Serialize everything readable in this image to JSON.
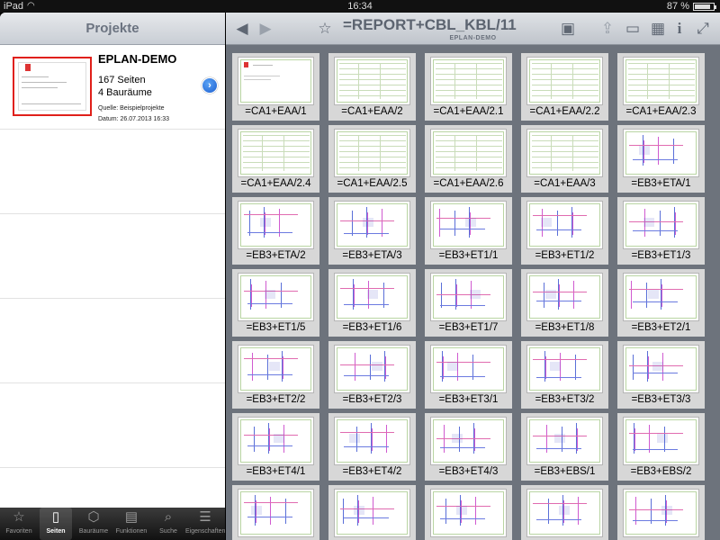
{
  "status": {
    "device": "iPad",
    "time": "16:34",
    "battery": "87 %",
    "battery_level": 0.87
  },
  "master": {
    "title": "Projekte",
    "project": {
      "name": "EPLAN-DEMO",
      "pages": "167 Seiten",
      "rooms": "4 Bauräume",
      "source": "Quelle: Beispielprojekte",
      "date": "Datum: 26.07.2013 16:33"
    }
  },
  "tabs": [
    {
      "label": "Favoriten",
      "icon": "star-icon",
      "active": false
    },
    {
      "label": "Seiten",
      "icon": "page-icon",
      "active": true
    },
    {
      "label": "Bauräume",
      "icon": "cube-icon",
      "active": false
    },
    {
      "label": "Funktionen",
      "icon": "function-icon",
      "active": false
    },
    {
      "label": "Suche",
      "icon": "search-icon",
      "active": false
    },
    {
      "label": "Eigenschaften",
      "icon": "properties-icon",
      "active": false
    }
  ],
  "detail": {
    "title": "=REPORT+CBL_KBL/11",
    "subtitle": "EPLAN-DEMO",
    "pages": [
      {
        "label": "=CA1+EAA/1",
        "kind": "cover"
      },
      {
        "label": "=CA1+EAA/2",
        "kind": "table"
      },
      {
        "label": "=CA1+EAA/2.1",
        "kind": "table"
      },
      {
        "label": "=CA1+EAA/2.2",
        "kind": "table"
      },
      {
        "label": "=CA1+EAA/2.3",
        "kind": "table"
      },
      {
        "label": "=CA1+EAA/2.4",
        "kind": "table"
      },
      {
        "label": "=CA1+EAA/2.5",
        "kind": "table"
      },
      {
        "label": "=CA1+EAA/2.6",
        "kind": "table"
      },
      {
        "label": "=CA1+EAA/3",
        "kind": "list"
      },
      {
        "label": "=EB3+ETA/1",
        "kind": "schematic"
      },
      {
        "label": "=EB3+ETA/2",
        "kind": "schematic"
      },
      {
        "label": "=EB3+ETA/3",
        "kind": "schematic"
      },
      {
        "label": "=EB3+ET1/1",
        "kind": "schematic"
      },
      {
        "label": "=EB3+ET1/2",
        "kind": "schematic"
      },
      {
        "label": "=EB3+ET1/3",
        "kind": "schematic"
      },
      {
        "label": "=EB3+ET1/5",
        "kind": "schematic"
      },
      {
        "label": "=EB3+ET1/6",
        "kind": "schematic"
      },
      {
        "label": "=EB3+ET1/7",
        "kind": "schematic"
      },
      {
        "label": "=EB3+ET1/8",
        "kind": "schematic"
      },
      {
        "label": "=EB3+ET2/1",
        "kind": "schematic"
      },
      {
        "label": "=EB3+ET2/2",
        "kind": "schematic"
      },
      {
        "label": "=EB3+ET2/3",
        "kind": "schematic"
      },
      {
        "label": "=EB3+ET3/1",
        "kind": "schematic"
      },
      {
        "label": "=EB3+ET3/2",
        "kind": "schematic"
      },
      {
        "label": "=EB3+ET3/3",
        "kind": "schematic"
      },
      {
        "label": "=EB3+ET4/1",
        "kind": "schematic"
      },
      {
        "label": "=EB3+ET4/2",
        "kind": "schematic"
      },
      {
        "label": "=EB3+ET4/3",
        "kind": "schematic"
      },
      {
        "label": "=EB3+EBS/1",
        "kind": "schematic"
      },
      {
        "label": "=EB3+EBS/2",
        "kind": "schematic"
      },
      {
        "label": "",
        "kind": "schematic"
      },
      {
        "label": "",
        "kind": "schematic"
      },
      {
        "label": "",
        "kind": "schematic"
      },
      {
        "label": "",
        "kind": "schematic"
      },
      {
        "label": "",
        "kind": "schematic"
      }
    ]
  },
  "colors": {
    "accent": "#1d5fd0",
    "thumb_border": "#e0201a",
    "grid_bg": "#6d737c"
  }
}
